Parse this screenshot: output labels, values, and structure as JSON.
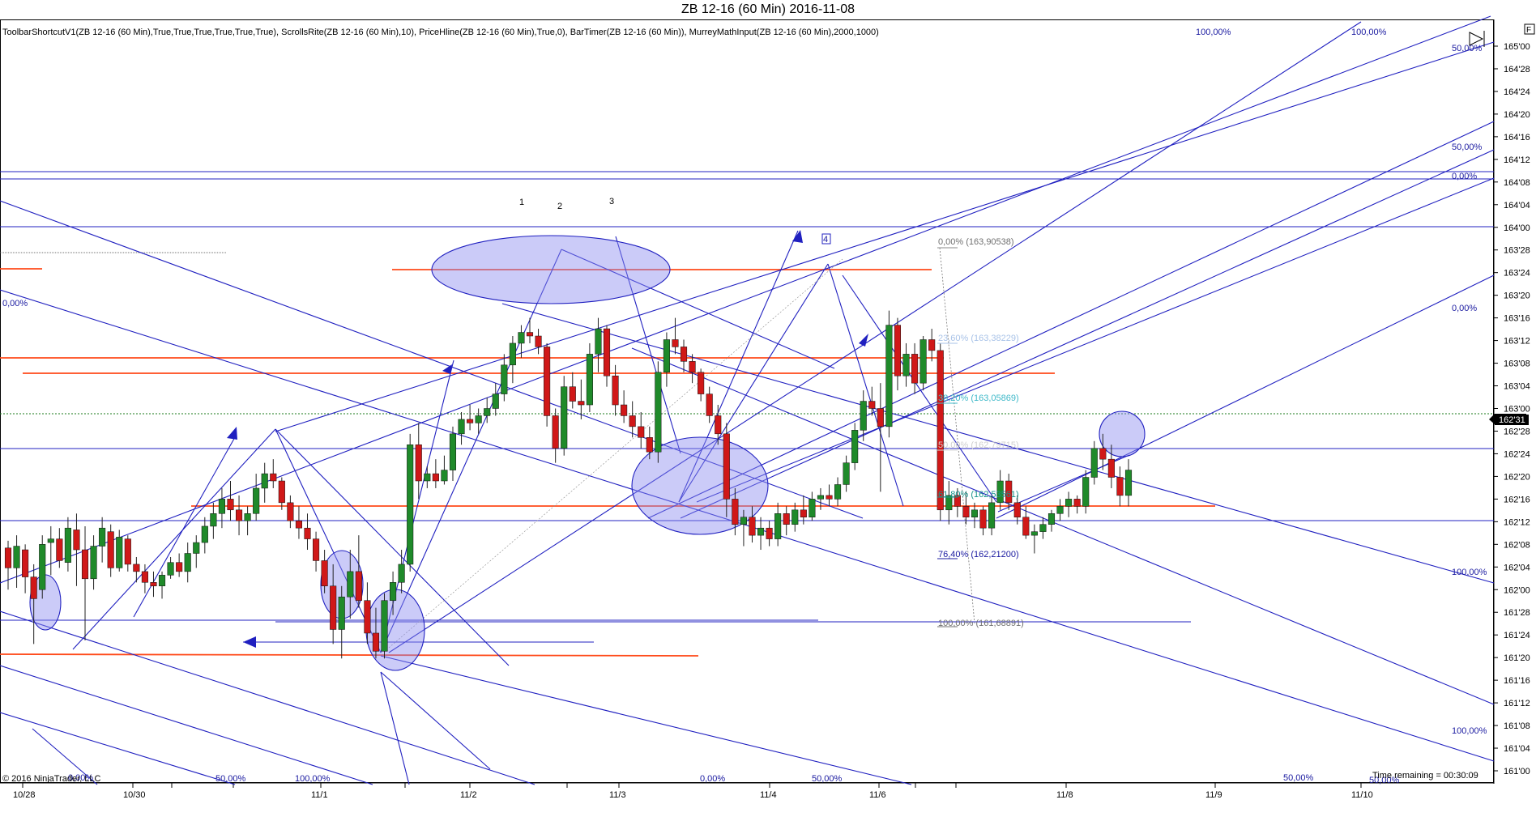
{
  "window": {
    "title": "ZB 12-16 (60 Min)  2016-11-08"
  },
  "indicators_text": "ToolbarShortcutV1(ZB 12-16 (60 Min),True,True,True,True,True,True), ScrollsRite(ZB 12-16 (60 Min),10), PriceHline(ZB 12-16 (60 Min),True,0), BarTimer(ZB 12-16 (60 Min)), MurreyMathInput(ZB 12-16 (60 Min),2000,1000)",
  "copyright": "© 2016 NinjaTrader, LLC",
  "time_remaining": "Time remaining = 00:30:09",
  "last_price": "162'31",
  "corner_flag": "F",
  "colors": {
    "up": "#1f8a2a",
    "down": "#d01818",
    "blue_line": "#2020c0",
    "orange_line": "#ff4a1a",
    "ellipse_fill": "#8c8cf0",
    "price_line": "#1a7a1a"
  },
  "chart_data": {
    "type": "candlestick",
    "title": "ZB 12-16 (60 Min)  2016-11-08",
    "y_ticks": [
      "165'00",
      "164'28",
      "164'24",
      "164'20",
      "164'16",
      "164'12",
      "164'08",
      "164'04",
      "164'00",
      "163'28",
      "163'24",
      "163'20",
      "163'16",
      "163'12",
      "163'08",
      "163'04",
      "163'00",
      "162'28",
      "162'24",
      "162'20",
      "162'16",
      "162'12",
      "162'08",
      "162'04",
      "162'00",
      "161'28",
      "161'24",
      "161'20",
      "161'16",
      "161'12",
      "161'08",
      "161'04",
      "161'00"
    ],
    "y_range_32nds": [
      161.0,
      165.0
    ],
    "x_ticks": [
      "10/28",
      "10/30",
      "11/1",
      "11/2",
      "11/3",
      "11/4",
      "11/6",
      "11/8",
      "11/9",
      "11/10"
    ],
    "candles_open_high_low_close": [
      [
        162.23,
        162.27,
        162.0,
        162.12
      ],
      [
        162.12,
        162.3,
        162.01,
        162.24
      ],
      [
        162.22,
        162.25,
        161.98,
        162.07
      ],
      [
        162.07,
        162.14,
        161.7,
        161.95
      ],
      [
        162.0,
        162.3,
        161.95,
        162.25
      ],
      [
        162.26,
        162.35,
        162.08,
        162.28
      ],
      [
        162.28,
        162.34,
        162.12,
        162.16
      ],
      [
        162.15,
        162.4,
        162.1,
        162.34
      ],
      [
        162.33,
        162.42,
        162.02,
        162.22
      ],
      [
        162.22,
        162.35,
        161.72,
        162.06
      ],
      [
        162.06,
        162.3,
        162.0,
        162.24
      ],
      [
        162.24,
        162.4,
        162.15,
        162.34
      ],
      [
        162.32,
        162.36,
        162.07,
        162.12
      ],
      [
        162.12,
        162.33,
        162.1,
        162.29
      ],
      [
        162.28,
        162.3,
        162.1,
        162.14
      ],
      [
        162.14,
        162.18,
        162.04,
        162.1
      ],
      [
        162.1,
        162.14,
        161.98,
        162.04
      ],
      [
        162.04,
        162.1,
        161.96,
        162.02
      ],
      [
        162.02,
        162.1,
        161.95,
        162.08
      ],
      [
        162.08,
        162.18,
        162.06,
        162.15
      ],
      [
        162.15,
        162.2,
        162.07,
        162.1
      ],
      [
        162.1,
        162.26,
        162.04,
        162.2
      ],
      [
        162.2,
        162.3,
        162.12,
        162.26
      ],
      [
        162.26,
        162.4,
        162.2,
        162.35
      ],
      [
        162.35,
        162.48,
        162.28,
        162.42
      ],
      [
        162.42,
        162.56,
        162.34,
        162.5
      ],
      [
        162.5,
        162.6,
        162.38,
        162.44
      ],
      [
        162.44,
        162.52,
        162.3,
        162.38
      ],
      [
        162.38,
        162.46,
        162.3,
        162.42
      ],
      [
        162.42,
        162.64,
        162.38,
        162.56
      ],
      [
        162.56,
        162.7,
        162.48,
        162.64
      ],
      [
        162.64,
        162.72,
        162.56,
        162.6
      ],
      [
        162.6,
        162.62,
        162.44,
        162.48
      ],
      [
        162.48,
        162.52,
        162.34,
        162.38
      ],
      [
        162.38,
        162.46,
        162.28,
        162.34
      ],
      [
        162.34,
        162.42,
        162.22,
        162.28
      ],
      [
        162.28,
        162.32,
        162.1,
        162.16
      ],
      [
        162.16,
        162.22,
        161.98,
        162.02
      ],
      [
        162.02,
        162.14,
        161.7,
        161.78
      ],
      [
        161.78,
        162.02,
        161.62,
        161.96
      ],
      [
        161.96,
        162.22,
        161.84,
        162.1
      ],
      [
        162.1,
        162.3,
        161.9,
        161.94
      ],
      [
        161.94,
        162.04,
        161.7,
        161.76
      ],
      [
        161.76,
        161.9,
        161.62,
        161.66
      ],
      [
        161.66,
        161.98,
        161.62,
        161.94
      ],
      [
        161.94,
        162.1,
        161.86,
        162.04
      ],
      [
        162.04,
        162.22,
        161.98,
        162.14
      ],
      [
        162.14,
        162.86,
        162.1,
        162.8
      ],
      [
        162.8,
        162.92,
        162.5,
        162.6
      ],
      [
        162.6,
        162.68,
        162.56,
        162.64
      ],
      [
        162.64,
        162.72,
        162.56,
        162.6
      ],
      [
        162.6,
        162.74,
        162.58,
        162.66
      ],
      [
        162.66,
        162.9,
        162.6,
        162.86
      ],
      [
        162.86,
        162.98,
        162.8,
        162.94
      ],
      [
        162.94,
        163.02,
        162.88,
        162.92
      ],
      [
        162.92,
        163.0,
        162.86,
        162.96
      ],
      [
        162.96,
        163.06,
        162.92,
        163.0
      ],
      [
        163.0,
        163.14,
        162.96,
        163.08
      ],
      [
        163.08,
        163.3,
        163.04,
        163.24
      ],
      [
        163.24,
        163.4,
        163.14,
        163.36
      ],
      [
        163.36,
        163.46,
        163.28,
        163.42
      ],
      [
        163.42,
        163.5,
        163.36,
        163.4
      ],
      [
        163.4,
        163.44,
        163.3,
        163.34
      ],
      [
        163.34,
        163.36,
        162.9,
        162.96
      ],
      [
        162.96,
        163.0,
        162.7,
        162.78
      ],
      [
        162.78,
        163.18,
        162.74,
        163.12
      ],
      [
        163.12,
        163.2,
        163.0,
        163.04
      ],
      [
        163.04,
        163.16,
        162.94,
        163.02
      ],
      [
        163.02,
        163.36,
        162.98,
        163.3
      ],
      [
        163.3,
        163.5,
        163.2,
        163.44
      ],
      [
        163.44,
        163.46,
        163.12,
        163.18
      ],
      [
        163.18,
        163.24,
        162.96,
        163.02
      ],
      [
        163.02,
        163.1,
        162.92,
        162.96
      ],
      [
        162.96,
        163.04,
        162.84,
        162.9
      ],
      [
        162.9,
        162.98,
        162.78,
        162.84
      ],
      [
        162.84,
        162.9,
        162.72,
        162.76
      ],
      [
        162.76,
        163.26,
        162.7,
        163.2
      ],
      [
        163.2,
        163.42,
        163.12,
        163.38
      ],
      [
        163.38,
        163.5,
        163.3,
        163.34
      ],
      [
        163.34,
        163.38,
        163.2,
        163.26
      ],
      [
        163.26,
        163.3,
        163.14,
        163.2
      ],
      [
        163.2,
        163.22,
        163.04,
        163.08
      ],
      [
        163.08,
        163.12,
        162.92,
        162.96
      ],
      [
        162.96,
        163.02,
        162.8,
        162.86
      ],
      [
        162.86,
        162.92,
        162.4,
        162.5
      ],
      [
        162.5,
        162.56,
        162.3,
        162.36
      ],
      [
        162.36,
        162.44,
        162.24,
        162.4
      ],
      [
        162.4,
        162.46,
        162.26,
        162.3
      ],
      [
        162.3,
        162.4,
        162.22,
        162.34
      ],
      [
        162.34,
        162.38,
        162.24,
        162.28
      ],
      [
        162.28,
        162.48,
        162.24,
        162.42
      ],
      [
        162.42,
        162.46,
        162.3,
        162.36
      ],
      [
        162.36,
        162.48,
        162.32,
        162.44
      ],
      [
        162.44,
        162.52,
        162.36,
        162.4
      ],
      [
        162.4,
        162.54,
        162.38,
        162.5
      ],
      [
        162.5,
        162.56,
        162.44,
        162.52
      ],
      [
        162.52,
        162.58,
        162.46,
        162.5
      ],
      [
        162.5,
        162.62,
        162.46,
        162.58
      ],
      [
        162.58,
        162.74,
        162.54,
        162.7
      ],
      [
        162.7,
        162.92,
        162.66,
        162.88
      ],
      [
        162.88,
        163.1,
        162.82,
        163.04
      ],
      [
        163.04,
        163.12,
        162.96,
        163.0
      ],
      [
        163.0,
        163.14,
        162.54,
        162.9
      ],
      [
        162.9,
        163.54,
        162.84,
        163.46
      ],
      [
        163.46,
        163.5,
        163.1,
        163.18
      ],
      [
        163.18,
        163.36,
        163.12,
        163.3
      ],
      [
        163.3,
        163.36,
        163.08,
        163.14
      ],
      [
        163.14,
        163.4,
        163.1,
        163.38
      ],
      [
        163.38,
        163.44,
        163.26,
        163.32
      ],
      [
        163.32,
        163.36,
        162.38,
        162.44
      ],
      [
        162.44,
        162.6,
        162.36,
        162.52
      ],
      [
        162.52,
        162.56,
        162.4,
        162.46
      ],
      [
        162.46,
        162.54,
        162.36,
        162.4
      ],
      [
        162.4,
        162.48,
        162.34,
        162.44
      ],
      [
        162.44,
        162.46,
        162.3,
        162.34
      ],
      [
        162.34,
        162.52,
        162.3,
        162.48
      ],
      [
        162.48,
        162.66,
        162.44,
        162.6
      ],
      [
        162.6,
        162.64,
        162.44,
        162.48
      ],
      [
        162.48,
        162.52,
        162.36,
        162.4
      ],
      [
        162.4,
        162.46,
        162.28,
        162.3
      ],
      [
        162.3,
        162.36,
        162.2,
        162.32
      ],
      [
        162.32,
        162.4,
        162.28,
        162.36
      ],
      [
        162.36,
        162.44,
        162.32,
        162.42
      ],
      [
        162.42,
        162.5,
        162.38,
        162.46
      ],
      [
        162.46,
        162.54,
        162.4,
        162.5
      ],
      [
        162.5,
        162.52,
        162.42,
        162.46
      ],
      [
        162.46,
        162.66,
        162.42,
        162.62
      ],
      [
        162.62,
        162.82,
        162.58,
        162.78
      ],
      [
        162.78,
        162.86,
        162.66,
        162.72
      ],
      [
        162.72,
        162.8,
        162.56,
        162.62
      ],
      [
        162.62,
        162.68,
        162.46,
        162.52
      ],
      [
        162.52,
        162.72,
        162.46,
        162.66
      ]
    ],
    "number_labels": [
      "1",
      "2",
      "3",
      "4"
    ],
    "fib_labels": [
      "0,00% (163,90538)",
      "23,60% (163,38229)",
      "38,20% (163,05869)",
      "50,00% (162,79715)",
      "61,80% (162,53561)",
      "76,40% (162,21200)",
      "100,00% (161,68891)"
    ],
    "blue_labels": [
      "100,00%",
      "100,00%",
      "50,00%",
      "50,00%",
      "0,00%",
      "0,00%",
      "0,00%",
      "100,00%",
      "100,00%",
      "50,00%",
      "50,00%",
      "100,00%",
      "0,00%",
      "50,00%",
      "0,00%",
      "50,00%"
    ]
  }
}
